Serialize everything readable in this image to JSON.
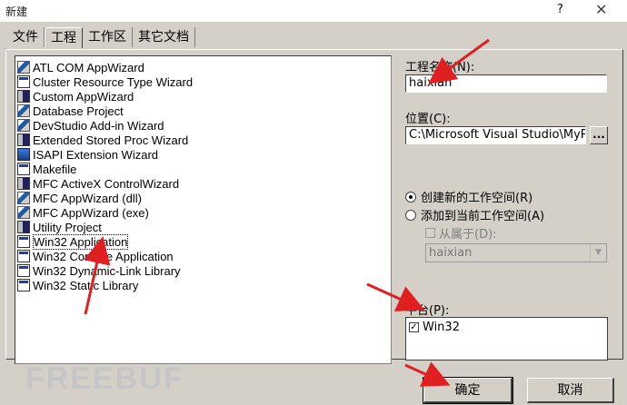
{
  "window": {
    "title": "新建",
    "help_glyph": "?",
    "close_glyph": "✕"
  },
  "tabs": [
    {
      "label": "文件"
    },
    {
      "label": "工程",
      "active": true
    },
    {
      "label": "工作区"
    },
    {
      "label": "其它文档"
    }
  ],
  "project_types": [
    {
      "label": "ATL COM AppWizard",
      "icon": "atl-wizard-icon"
    },
    {
      "label": "Cluster Resource Type Wizard",
      "icon": "cluster-icon"
    },
    {
      "label": "Custom AppWizard",
      "icon": "custom-wizard-icon"
    },
    {
      "label": "Database Project",
      "icon": "database-icon"
    },
    {
      "label": "DevStudio Add-in Wizard",
      "icon": "addin-icon"
    },
    {
      "label": "Extended Stored Proc Wizard",
      "icon": "stored-proc-icon"
    },
    {
      "label": "ISAPI Extension Wizard",
      "icon": "isapi-globe-icon"
    },
    {
      "label": "Makefile",
      "icon": "makefile-icon"
    },
    {
      "label": "MFC ActiveX ControlWizard",
      "icon": "activex-icon"
    },
    {
      "label": "MFC AppWizard (dll)",
      "icon": "mfc-dll-icon"
    },
    {
      "label": "MFC AppWizard (exe)",
      "icon": "mfc-exe-icon"
    },
    {
      "label": "Utility Project",
      "icon": "utility-icon"
    },
    {
      "label": "Win32 Application",
      "icon": "win32-app-icon",
      "selected": true
    },
    {
      "label": "Win32 Console Application",
      "icon": "console-icon"
    },
    {
      "label": "Win32 Dynamic-Link Library",
      "icon": "dll-icon"
    },
    {
      "label": "Win32 Static Library",
      "icon": "static-lib-icon"
    }
  ],
  "project_name": {
    "label": "工程名称(N):",
    "value": "haixian"
  },
  "location": {
    "label": "位置(C):",
    "value": "C:\\Microsoft Visual Studio\\MyPro",
    "browse_label": "..."
  },
  "workspace_options": [
    {
      "label": "创建新的工作空间(R)",
      "selected": true
    },
    {
      "label": "添加到当前工作空间(A)",
      "selected": false
    }
  ],
  "dependency": {
    "label": "从属于(D):",
    "checked": false,
    "value": "haixian"
  },
  "platform": {
    "label": "平台(P):",
    "items": [
      {
        "label": "Win32",
        "checked": true
      }
    ]
  },
  "buttons": {
    "ok": "确定",
    "cancel": "取消"
  },
  "watermark": "FREEBUF",
  "colors": {
    "dialog_bg": "#d4d0c8",
    "annotation_red": "#e02020"
  }
}
